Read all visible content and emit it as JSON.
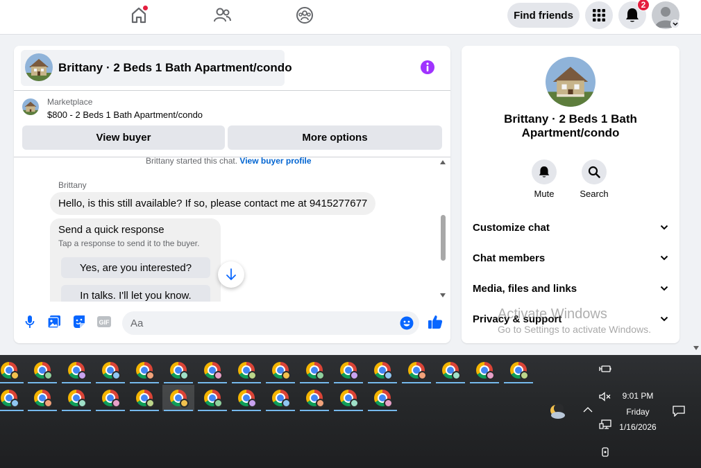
{
  "topbar": {
    "find_friends": "Find friends",
    "notification_count": "2"
  },
  "chat": {
    "title": "Brittany · 2 Beds 1 Bath Apartment/condo",
    "marketplace_label": "Marketplace",
    "listing": "$800 - 2 Beds 1 Bath Apartment/condo",
    "view_buyer": "View buyer",
    "more_options": "More options",
    "started_text": "Brittany started this chat.",
    "view_buyer_profile": "View buyer profile",
    "sender": "Brittany",
    "message": "Hello, is this still available? If so, please contact me at 9415277677",
    "quick_response_title": "Send a quick response",
    "quick_response_sub": "Tap a response to send it to the buyer.",
    "quick_responses": [
      "Yes, are you interested?",
      "In talks. I'll let you know."
    ],
    "composer_placeholder": "Aa",
    "gif_label": "GIF"
  },
  "details": {
    "name_line1": "Brittany · 2 Beds 1 Bath",
    "name_line2": "Apartment/condo",
    "mute": "Mute",
    "search": "Search",
    "sections": [
      "Customize chat",
      "Chat members",
      "Media, files and links",
      "Privacy & support"
    ]
  },
  "watermark": {
    "title": "Activate Windows",
    "subtitle": "Go to Settings to activate Windows."
  },
  "taskbar": {
    "time": "9:01 PM",
    "day": "Friday",
    "date": "1/16/2026"
  },
  "colors": {
    "accent": "#0866ff",
    "info_purple": "#a033ff",
    "badge_red": "#e41e3f"
  },
  "icons": [
    "home-icon",
    "friends-icon",
    "groups-icon",
    "grid-menu-icon",
    "bell-icon",
    "info-icon",
    "mic-icon",
    "photo-icon",
    "sticker-icon",
    "gif-icon",
    "emoji-icon",
    "like-icon",
    "mute-bell-icon",
    "search-icon",
    "chevron-down-icon",
    "chrome-icon",
    "weather-icon",
    "speaker-muted-icon",
    "network-icon",
    "notification-icon"
  ]
}
